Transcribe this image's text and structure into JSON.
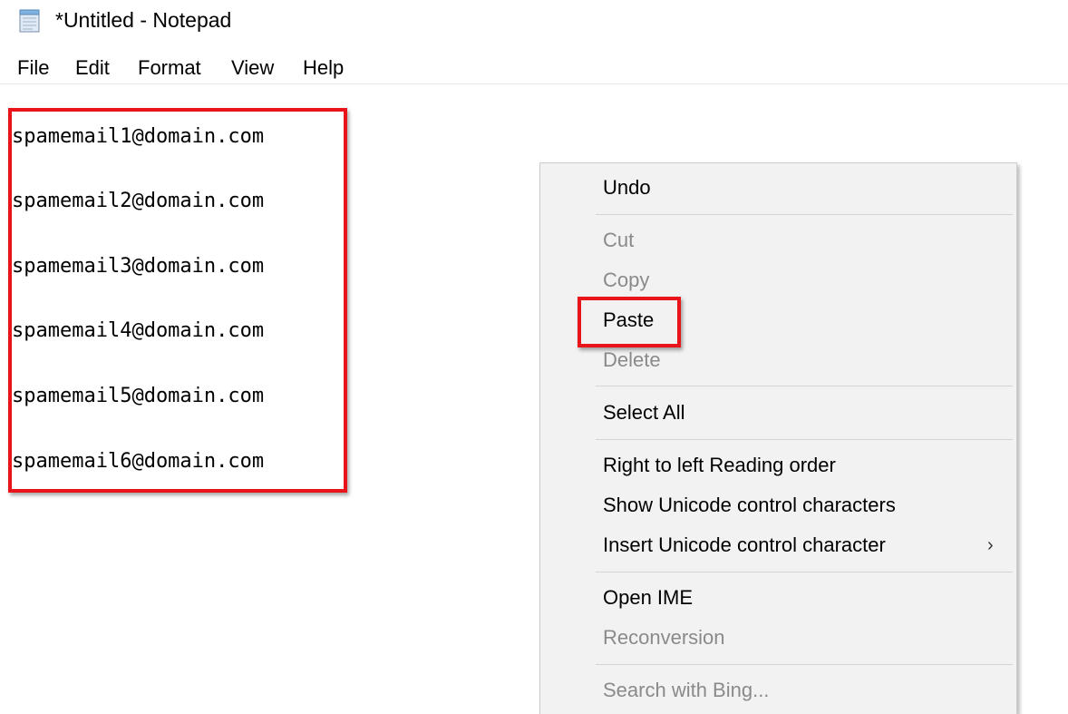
{
  "window": {
    "title": "*Untitled - Notepad",
    "icon": "notepad-icon"
  },
  "menubar": {
    "items": [
      "File",
      "Edit",
      "Format",
      "View",
      "Help"
    ]
  },
  "editor": {
    "lines": [
      "spamemail1@domain.com",
      "spamemail2@domain.com",
      "spamemail3@domain.com",
      "spamemail4@domain.com",
      "spamemail5@domain.com",
      "spamemail6@domain.com"
    ]
  },
  "context_menu": {
    "items": [
      {
        "label": "Undo",
        "enabled": true
      },
      {
        "label": "Cut",
        "enabled": false
      },
      {
        "label": "Copy",
        "enabled": false
      },
      {
        "label": "Paste",
        "enabled": true
      },
      {
        "label": "Delete",
        "enabled": false
      },
      {
        "label": "Select All",
        "enabled": true
      },
      {
        "label": "Right to left Reading order",
        "enabled": true
      },
      {
        "label": "Show Unicode control characters",
        "enabled": true
      },
      {
        "label": "Insert Unicode control character",
        "enabled": true,
        "submenu_arrow": "›"
      },
      {
        "label": "Open IME",
        "enabled": true
      },
      {
        "label": "Reconversion",
        "enabled": false
      },
      {
        "label": "Search with Bing...",
        "enabled": false
      }
    ]
  },
  "colors": {
    "highlight": "#e8141a",
    "disabled_text": "#8a8a8a",
    "menu_background": "#f2f2f2"
  }
}
